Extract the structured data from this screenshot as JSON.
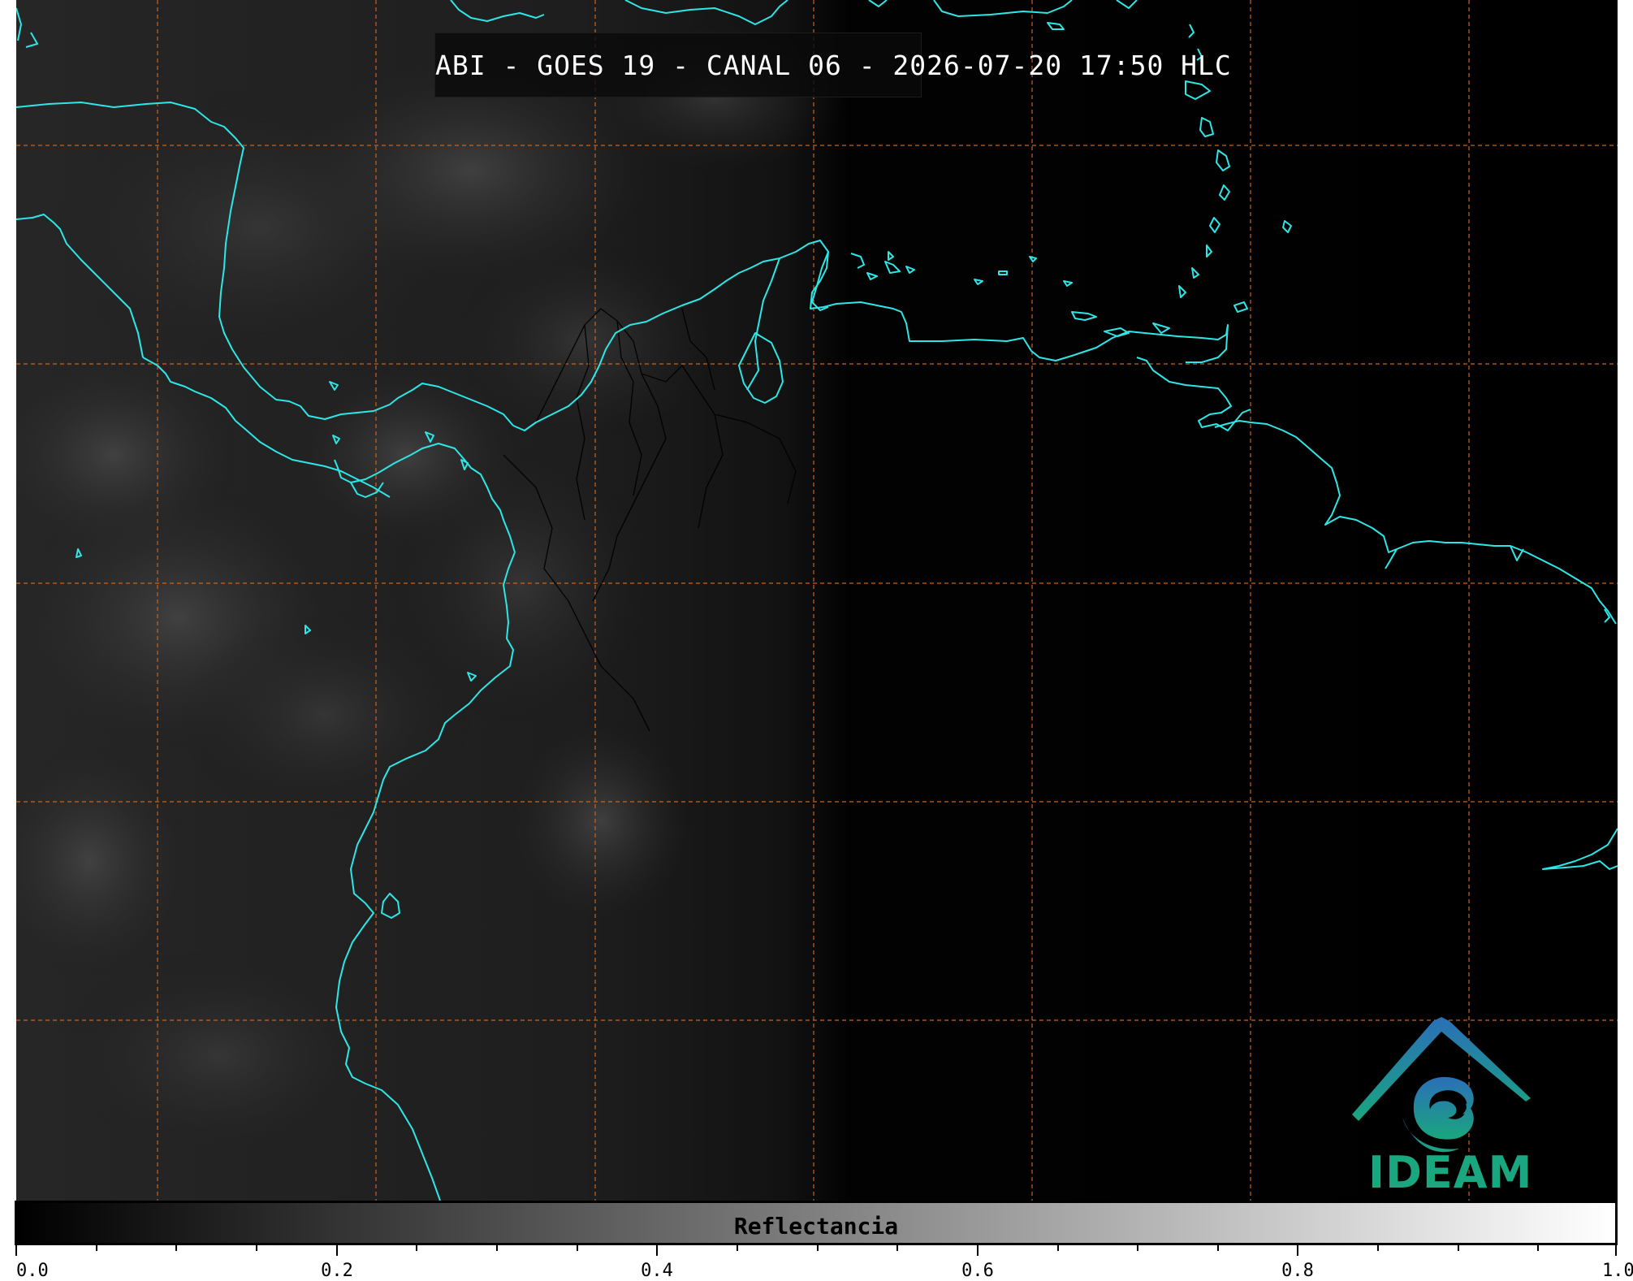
{
  "title": "ABI - GOES 19 - CANAL 06 - 2026-07-20 17:50 HLC",
  "colorbar": {
    "label": "Reflectancia",
    "ticks": [
      "0.0",
      "0.2",
      "0.4",
      "0.6",
      "0.8",
      "1.0"
    ],
    "range": [
      0.0,
      1.0
    ],
    "colormap": "grayscale"
  },
  "logo": {
    "text": "IDEAM",
    "icon": "ideam-logo-icon"
  },
  "colors": {
    "coastline": "#2ee6e6",
    "grid": "#c8641e",
    "borders": "#000000",
    "logo_text": "#1aa67e",
    "logo_gradient_top": "#2a6fb8",
    "logo_gradient_bottom": "#1aa67e"
  }
}
